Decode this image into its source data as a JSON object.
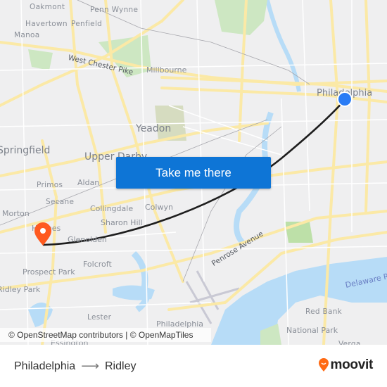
{
  "map": {
    "place_labels": [
      {
        "text": "Oakmont",
        "size": "sm"
      },
      {
        "text": "Penn Wynne",
        "size": "sm"
      },
      {
        "text": "Havertown",
        "size": "sm"
      },
      {
        "text": "Penfield",
        "size": "sm"
      },
      {
        "text": "Manoa",
        "size": "sm"
      },
      {
        "text": "Millbourne",
        "size": "md"
      },
      {
        "text": "Philadelphia",
        "size": "lg"
      },
      {
        "text": "Yeadon",
        "size": "lg"
      },
      {
        "text": "Springfield",
        "size": "lg"
      },
      {
        "text": "Upper Darby",
        "size": "lg"
      },
      {
        "text": "Primos",
        "size": "sm"
      },
      {
        "text": "Aldan",
        "size": "md"
      },
      {
        "text": "Secane",
        "size": "sm"
      },
      {
        "text": "Collingdale",
        "size": "md"
      },
      {
        "text": "Colwyn",
        "size": "md"
      },
      {
        "text": "Morton",
        "size": "md"
      },
      {
        "text": "Sharon Hill",
        "size": "md"
      },
      {
        "text": "Holmes",
        "size": "md"
      },
      {
        "text": "Glenolden",
        "size": "md"
      },
      {
        "text": "Folcroft",
        "size": "md"
      },
      {
        "text": "Prospect Park",
        "size": "md"
      },
      {
        "text": "Ridley Park",
        "size": "md"
      },
      {
        "text": "Lester",
        "size": "sm"
      },
      {
        "text": "Philadelphia",
        "size": "md"
      },
      {
        "text": "Essington",
        "size": "md"
      },
      {
        "text": "Red Bank",
        "size": "sm"
      },
      {
        "text": "National Park",
        "size": "md"
      },
      {
        "text": "Verga",
        "size": "sm"
      }
    ],
    "road_labels": [
      "West Chester Pike",
      "Penrose Avenue"
    ],
    "water_labels": [
      "Delaware River"
    ],
    "origin_marker": {
      "name": "Philadelphia",
      "color": "#2a7cf5"
    },
    "destination_marker": {
      "name": "Ridley",
      "color": "#ff5a1f"
    },
    "route_color": "#1e1e1e",
    "cta_label": "Take me there",
    "cta_color": "#0e75d6",
    "attribution": "© OpenStreetMap contributors | © OpenMapTiles"
  },
  "footer": {
    "origin": "Philadelphia",
    "arrow": "⟶",
    "destination": "Ridley",
    "brand": "moovit",
    "brand_color": "#ff6a13"
  }
}
